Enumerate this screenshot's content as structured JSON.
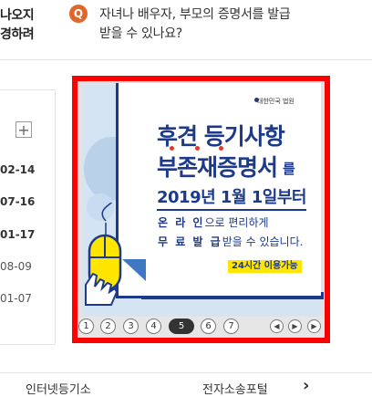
{
  "top_left": {
    "line1": "나오지",
    "line2": "경하려"
  },
  "faq": {
    "badge": "Q",
    "line1": "자녀나 배우자, 부모의 증명서를 발급",
    "line2": "받을 수 있나요?"
  },
  "list": {
    "add_label": "+",
    "dates": [
      "02-14",
      "07-16",
      "01-17",
      "08-09",
      "01-07"
    ]
  },
  "banner": {
    "logo_text": "대한민국 법원",
    "title1": "후견 등기사항",
    "title2": "부존재증명서",
    "title2_suffix": "를",
    "date_line": "2019년 1월 1일부터",
    "online_bold": "온 라 인",
    "online_rest": "으로 편리하게",
    "free_bold": "무 료  발 급",
    "free_rest": "받을 수 있습니다.",
    "badge": "24시간 이용가능"
  },
  "pager": {
    "pages": [
      "1",
      "2",
      "3",
      "4",
      "5",
      "6",
      "7"
    ],
    "active_page": "5",
    "prev_icon": "chevron-left-icon",
    "play_icon": "play-icon",
    "next_icon": "chevron-right-icon"
  },
  "bottom": {
    "left_text": "인터넷등기소",
    "right_text": "전자소송포털"
  },
  "colors": {
    "accent_red": "#ff0000",
    "navy": "#1d3a8a",
    "badge_yellow": "#ffe500",
    "q_orange": "#e0662b"
  }
}
